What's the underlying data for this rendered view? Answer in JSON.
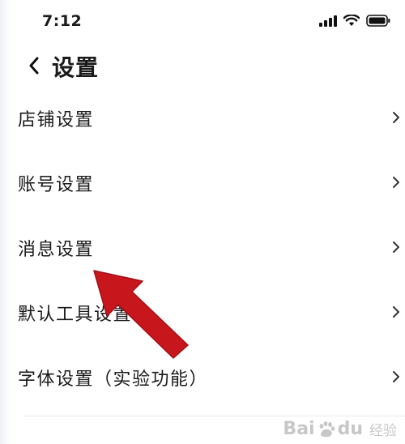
{
  "status_bar": {
    "time": "7:12",
    "icons": [
      "signal-icon",
      "wifi-icon",
      "battery-icon"
    ]
  },
  "header": {
    "back_icon": "chevron-left-icon",
    "title": "设置"
  },
  "menu": {
    "items": [
      {
        "label": "店铺设置"
      },
      {
        "label": "账号设置"
      },
      {
        "label": "消息设置"
      },
      {
        "label": "默认工具设置"
      },
      {
        "label": "字体设置（实验功能）"
      }
    ],
    "chevron_icon": "chevron-right-icon"
  },
  "annotation": {
    "arrow_color": "#c8161d",
    "points_to": "消息设置"
  },
  "watermark": {
    "brand": "Bai",
    "brand_suffix": "du",
    "sub": "经验"
  }
}
